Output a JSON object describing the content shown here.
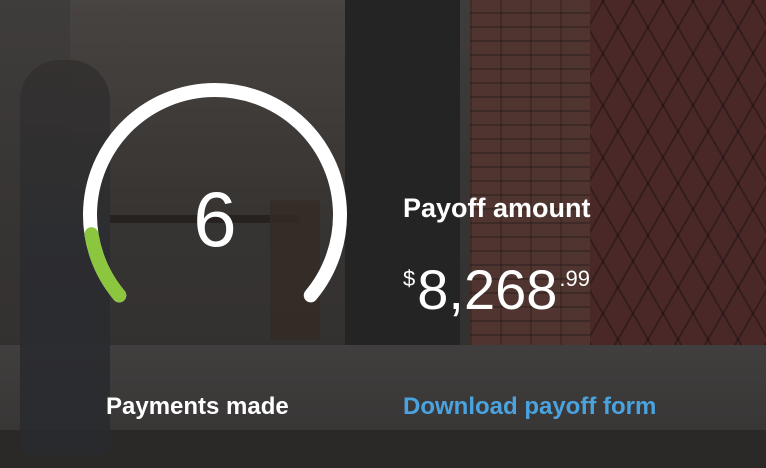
{
  "gauge": {
    "payments_made": "6",
    "label": "Payments made",
    "progress_fraction": 0.12,
    "track_color": "#ffffff",
    "progress_color": "#8cc63f"
  },
  "payoff": {
    "title": "Payoff amount",
    "currency_symbol": "$",
    "amount_whole": "8,268",
    "amount_cents": ".99",
    "download_link": "Download payoff form",
    "link_color": "#4aa3df"
  }
}
